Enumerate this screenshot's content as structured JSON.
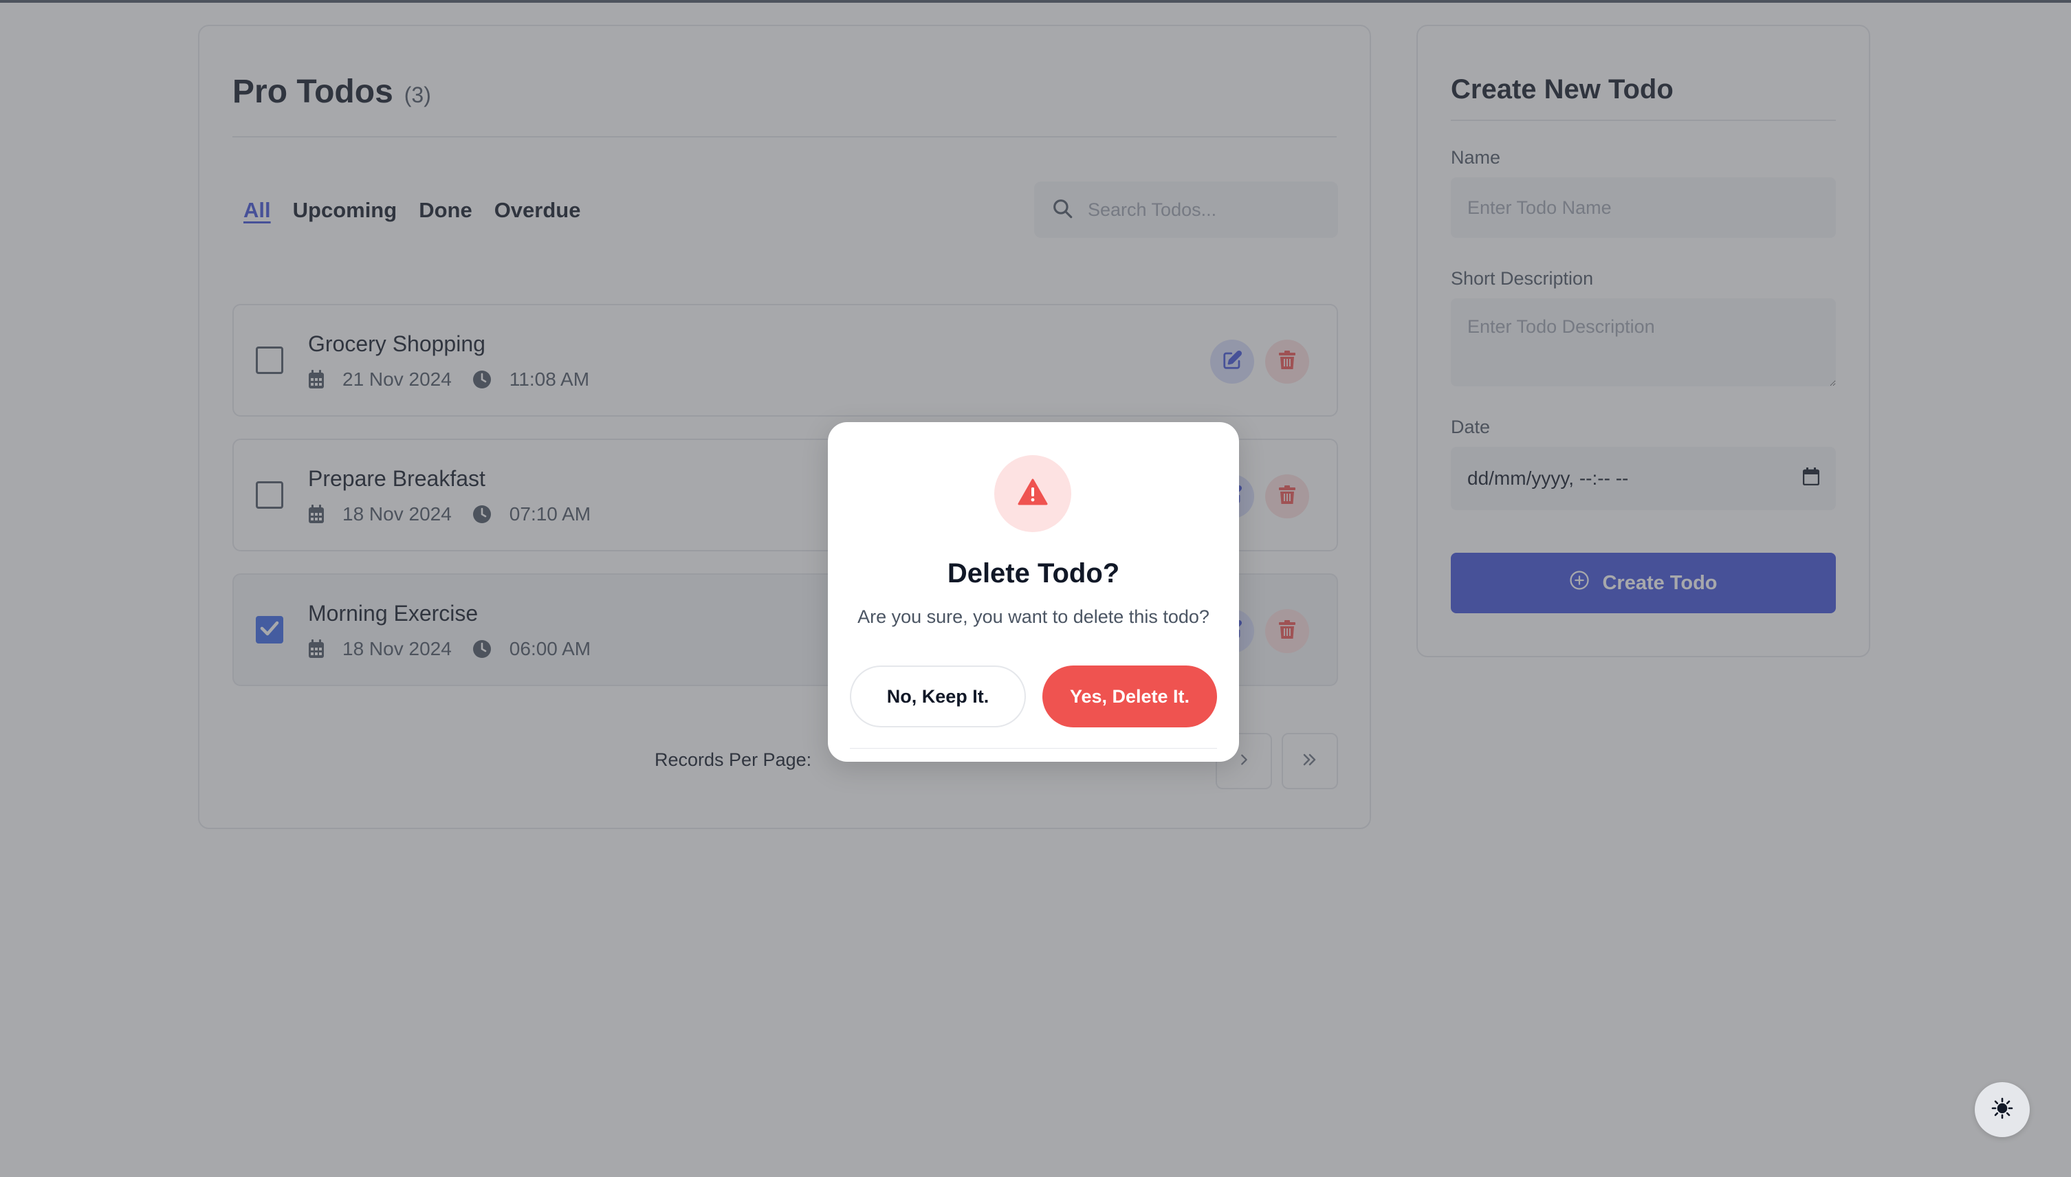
{
  "app": {
    "title": "Pro Todos",
    "count": "(3)"
  },
  "filters": [
    {
      "label": "All",
      "active": true
    },
    {
      "label": "Upcoming",
      "active": false
    },
    {
      "label": "Done",
      "active": false
    },
    {
      "label": "Overdue",
      "active": false
    }
  ],
  "search": {
    "placeholder": "Search Todos..."
  },
  "todos": [
    {
      "name": "Grocery Shopping",
      "date": "21 Nov 2024",
      "time": "11:08 AM",
      "done": false
    },
    {
      "name": "Prepare Breakfast",
      "date": "18 Nov 2024",
      "time": "07:10 AM",
      "done": false
    },
    {
      "name": "Morning Exercise",
      "date": "18 Nov 2024",
      "time": "06:00 AM",
      "done": true
    }
  ],
  "pagination": {
    "records_label": "Records Per Page:"
  },
  "create": {
    "title": "Create New Todo",
    "name_label": "Name",
    "name_placeholder": "Enter Todo Name",
    "desc_label": "Short Description",
    "desc_placeholder": "Enter Todo Description",
    "date_label": "Date",
    "date_value": "dd/mm/yyyy, --:-- --",
    "button": "Create Todo"
  },
  "modal": {
    "title": "Delete Todo?",
    "message": "Are you sure, you want to delete this todo?",
    "cancel": "No, Keep It.",
    "confirm": "Yes, Delete It."
  },
  "colors": {
    "primary": "#3f51d9",
    "danger": "#ef5350",
    "check": "#3867e8"
  },
  "icons": [
    "search-icon",
    "calendar-icon",
    "clock-icon",
    "edit-icon",
    "trash-icon",
    "chevron-right-icon",
    "double-chevron-right-icon",
    "plus-circle-icon",
    "warning-icon",
    "sun-icon",
    "checkmark-icon",
    "calendar-picker-icon"
  ]
}
